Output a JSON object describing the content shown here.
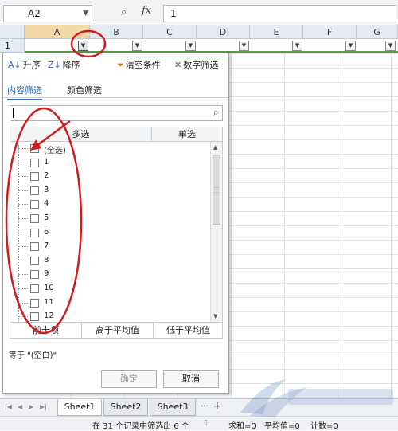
{
  "formula_bar": {
    "name_box": "A2",
    "zoom_icon": "magnifier-icon",
    "fx_label": "fx",
    "formula_value": "1"
  },
  "columns": [
    "A",
    "B",
    "C",
    "D",
    "E",
    "F",
    "G"
  ],
  "row_label": "1",
  "filter_popup": {
    "sort_asc": "升序",
    "sort_desc": "降序",
    "clear_filter": "清空条件",
    "number_filter": "数字筛选",
    "tab_content": "内容筛选",
    "tab_color": "颜色筛选",
    "search_value": "",
    "col_multi": "多选",
    "col_single": "单选",
    "items": [
      "(全选)",
      "1",
      "2",
      "3",
      "4",
      "5",
      "6",
      "7",
      "8",
      "9",
      "10",
      "11",
      "12"
    ],
    "top10": "前十项",
    "above_avg": "高于平均值",
    "below_avg": "低于平均值",
    "equal_label": "等于 \"(空白)\"",
    "ok": "确定",
    "cancel": "取消"
  },
  "sheets": [
    "Sheet1",
    "Sheet2",
    "Sheet3"
  ],
  "sheet_more": "···",
  "sheet_add": "+",
  "status": {
    "filter_msg": "在 31 个记录中筛选出 6 个",
    "sum": "求和=0",
    "avg": "平均值=0",
    "count": "计数=0"
  },
  "colors": {
    "annotation_red": "#d01c1c",
    "accent_blue": "#2f6fbd",
    "row_border_green": "#5b9a3e"
  }
}
